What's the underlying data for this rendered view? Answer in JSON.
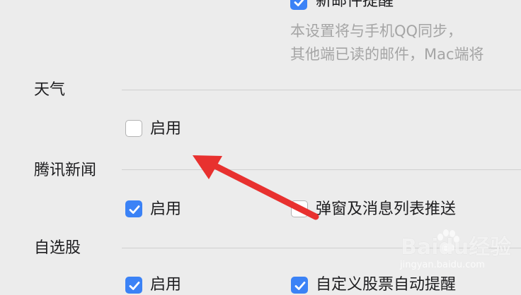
{
  "top_partial": {
    "checkbox_label": "新邮件提醒",
    "checked": true,
    "description_lines": [
      "本设置将与手机QQ同步，",
      "其他端已读的邮件，Mac端将"
    ]
  },
  "sections": {
    "weather": {
      "title": "天气",
      "enable_label": "启用",
      "enable_checked": false
    },
    "tencent_news": {
      "title": "腾讯新闻",
      "enable_label": "启用",
      "enable_checked": true,
      "popup_label": "弹窗及消息列表推送",
      "popup_checked": false
    },
    "stocks": {
      "title": "自选股",
      "enable_label": "启用",
      "enable_checked": true,
      "auto_label": "自定义股票自动提醒",
      "auto_checked": true
    }
  },
  "annotation": {
    "arrow_color": "#e8312f"
  },
  "watermark": {
    "brand": "Baidu经验",
    "url": "jingyan.baidu.com"
  },
  "colors": {
    "accent": "#3b82f6",
    "background": "#ececec"
  }
}
